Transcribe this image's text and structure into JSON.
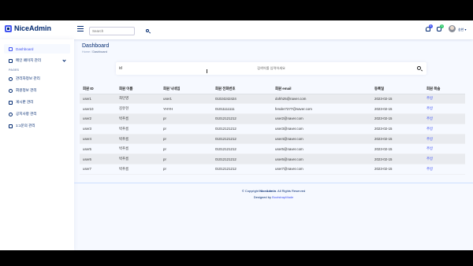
{
  "app": {
    "logo_text": "NiceAdmin"
  },
  "header": {
    "search_placeholder": "Search",
    "notifications_badge": "4",
    "messages_badge": "3",
    "user_name": "송한",
    "colors": {
      "notif": "#4154f1",
      "msg": "#2eca6a"
    }
  },
  "sidebar": {
    "items": [
      {
        "label": "Dashboard",
        "icon": "grid-icon"
      },
      {
        "label": "메인 페이지 관리",
        "icon": "menu-icon"
      }
    ],
    "heading": "PAGES",
    "pages": [
      {
        "label": "관리자정보 관리",
        "icon": "person-icon"
      },
      {
        "label": "회원정보 관리",
        "icon": "people-icon"
      },
      {
        "label": "게시판 관리",
        "icon": "board-icon"
      },
      {
        "label": "공지사항 관리",
        "icon": "question-icon"
      },
      {
        "label": "1:1문의 관리",
        "icon": "envelope-icon"
      }
    ]
  },
  "main": {
    "title": "Dashboard",
    "breadcrumb": {
      "home": "Home",
      "sep": "/",
      "current": "Dashboard"
    },
    "search": {
      "value": "id",
      "placeholder": "검색어를 입력하세요"
    },
    "table": {
      "headers": [
        "회원 ID",
        "회원 이름",
        "회원 닉네임",
        "회원 전화번호",
        "회원 email",
        "등록일",
        "회원 목숨"
      ],
      "rows": [
        [
          "user1",
          "최민영",
          "user1",
          "01024242424",
          "dohh25@naver.com",
          "2023-02-15",
          "추방"
        ],
        [
          "user10",
          "김유현",
          "YHYH",
          "01011111111",
          "fender7277@naver.com",
          "2023-02-15",
          "추방"
        ],
        [
          "user2",
          "박푸름",
          "pr",
          "01012121212",
          "user2@naver.com",
          "2023-02-15",
          "추방"
        ],
        [
          "user3",
          "박푸름",
          "pr",
          "01012121212",
          "user3@naver.com",
          "2023-02-15",
          "추방"
        ],
        [
          "user4",
          "박푸름",
          "pr",
          "01012121212",
          "user4@naver.com",
          "2023-02-15",
          "추방"
        ],
        [
          "user5",
          "박푸름",
          "pr",
          "01012121212",
          "user5@naver.com",
          "2023-02-15",
          "추방"
        ],
        [
          "user6",
          "박푸름",
          "pr",
          "01012121212",
          "user6@naver.com",
          "2023-02-15",
          "추방"
        ],
        [
          "user7",
          "박푸름",
          "pr",
          "01012121212",
          "user7@naver.com",
          "2023-02-15",
          "추방"
        ]
      ]
    }
  },
  "footer": {
    "copyright_prefix": "© Copyright ",
    "brand": "NiceAdmin",
    "copyright_suffix": ". All Rights Reserved",
    "designed_prefix": "Designed by ",
    "designer": "BootstrapMade"
  }
}
